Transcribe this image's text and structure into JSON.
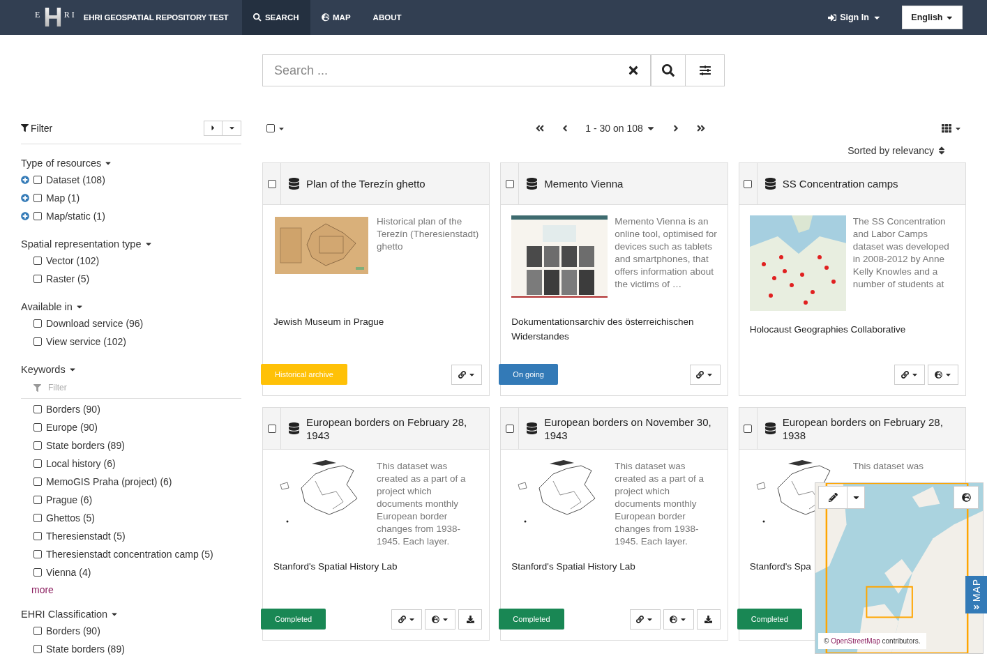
{
  "header": {
    "logo": [
      "E",
      "H",
      "RI"
    ],
    "site_title": "EHRI GEOSPATIAL REPOSITORY TEST",
    "nav": [
      {
        "label": "SEARCH",
        "kind": "search",
        "selected": true
      },
      {
        "label": "MAP",
        "kind": "globe",
        "selected": false
      },
      {
        "label": "ABOUT",
        "kind": "plain",
        "selected": false
      }
    ],
    "sign_in": "Sign In",
    "language": "English"
  },
  "search": {
    "placeholder": "Search ..."
  },
  "sidebar": {
    "title": "Filter",
    "sections": [
      {
        "title": "Type of resources",
        "items": [
          {
            "label": "Dataset (108)",
            "checked": false,
            "expandable": true
          },
          {
            "label": "Map (1)",
            "checked": false,
            "expandable": true
          },
          {
            "label": "Map/static (1)",
            "checked": false,
            "expandable": true
          }
        ]
      },
      {
        "title": "Spatial representation type",
        "items": [
          {
            "label": "Vector (102)",
            "checked": false,
            "expandable": false
          },
          {
            "label": "Raster (5)",
            "checked": false,
            "expandable": false
          }
        ]
      },
      {
        "title": "Available in",
        "items": [
          {
            "label": "Download service (96)",
            "checked": false,
            "expandable": false
          },
          {
            "label": "View service (102)",
            "checked": false,
            "expandable": false
          }
        ]
      },
      {
        "title": "Keywords",
        "filter_placeholder": "Filter",
        "items": [
          {
            "label": "Borders (90)",
            "checked": false,
            "expandable": false
          },
          {
            "label": "Europe (90)",
            "checked": false,
            "expandable": false
          },
          {
            "label": "State borders (89)",
            "checked": false,
            "expandable": false
          },
          {
            "label": "Local history (6)",
            "checked": false,
            "expandable": false
          },
          {
            "label": "MemoGIS Praha (project) (6)",
            "checked": false,
            "expandable": false
          },
          {
            "label": "Prague (6)",
            "checked": false,
            "expandable": false
          },
          {
            "label": "Ghettos (5)",
            "checked": false,
            "expandable": false
          },
          {
            "label": "Theresienstadt (5)",
            "checked": false,
            "expandable": false
          },
          {
            "label": "Theresienstadt concentration camp (5)",
            "checked": false,
            "expandable": false
          },
          {
            "label": "Vienna (4)",
            "checked": false,
            "expandable": false
          }
        ],
        "more": "more"
      },
      {
        "title": "EHRI Classification",
        "items": [
          {
            "label": "Borders (90)",
            "checked": false,
            "expandable": false
          },
          {
            "label": "State borders (89)",
            "checked": false,
            "expandable": false
          }
        ]
      }
    ]
  },
  "toolbar": {
    "select_all": {
      "checked": false
    },
    "page_range": "1 - 30 on 108",
    "sort": "Sorted by relevancy"
  },
  "results": [
    {
      "title": "Plan of the Terezín ghetto",
      "checked": false,
      "image": {
        "kind": "plan"
      },
      "description": "Historical plan of the Terezín (Theresienstadt) ghetto",
      "publisher": "Jewish Museum in Prague",
      "status": {
        "label": "Historical archive",
        "color": "#ffc107"
      },
      "actions": [
        {
          "kind": "link"
        }
      ]
    },
    {
      "title": "Memento Vienna",
      "checked": false,
      "image": {
        "kind": "poster"
      },
      "description": "Memento Vienna is an online tool, optimised for devices such as tablets and smartphones, that offers information about the victims of  …",
      "publisher": "Dokumentationsarchiv des österreichischen Widerstandes",
      "status": {
        "label": "On going",
        "color": "#337ab7"
      },
      "actions": [
        {
          "kind": "link"
        }
      ]
    },
    {
      "title": "SS Concentration camps",
      "checked": false,
      "image": {
        "kind": "dotmap"
      },
      "description": "The SS Concentration and Labor Camps dataset was developed in 2008-2012 by Anne Kelly Knowles and a number of students at",
      "publisher": "Holocaust Geographies Collaborative",
      "actions": [
        {
          "kind": "link"
        },
        {
          "kind": "globe"
        }
      ]
    },
    {
      "title": "European borders on February 28, 1943",
      "checked": false,
      "image": {
        "kind": "borders"
      },
      "description": "This dataset was created as a part of a project which documents monthly European border changes from 1938-1945. Each layer.",
      "publisher": "Stanford's Spatial History Lab",
      "status": {
        "label": "Completed",
        "color": "#198754"
      },
      "actions": [
        {
          "kind": "link"
        },
        {
          "kind": "globe"
        },
        {
          "kind": "download"
        }
      ]
    },
    {
      "title": "European borders on November 30, 1943",
      "checked": false,
      "image": {
        "kind": "borders"
      },
      "description": "This dataset was created as a part of a project which documents monthly European border changes from 1938-1945. Each layer.",
      "publisher": "Stanford's Spatial History Lab",
      "status": {
        "label": "Completed",
        "color": "#198754"
      },
      "actions": [
        {
          "kind": "link"
        },
        {
          "kind": "globe"
        },
        {
          "kind": "download"
        }
      ]
    },
    {
      "title": "European borders on February 28, 1938",
      "checked": false,
      "image": {
        "kind": "borders"
      },
      "description": "This dataset was",
      "publisher": "Stanford's Spa",
      "status": {
        "label": "Completed",
        "color": "#198754"
      }
    }
  ],
  "map_panel": {
    "attribution_prefix": "©",
    "attribution_link": "OpenStreetMap",
    "attribution_suffix": "contributors.",
    "tab_label": "MAP"
  }
}
